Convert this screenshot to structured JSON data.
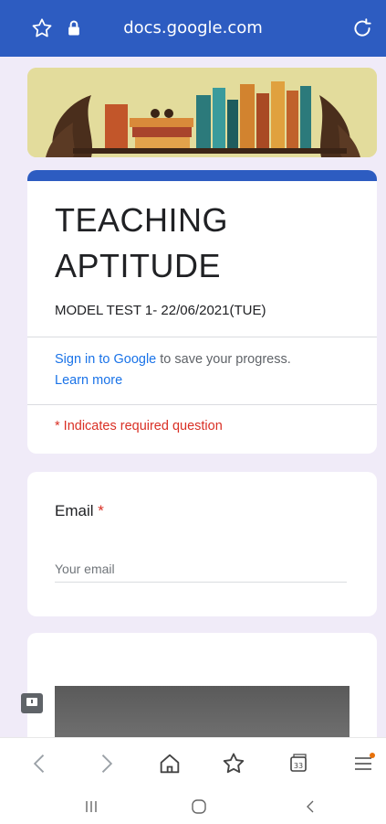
{
  "browser": {
    "url": "docs.google.com",
    "icons": [
      "star-icon",
      "lock-icon",
      "reload-icon"
    ]
  },
  "form": {
    "title": "TEACHING APTITUDE",
    "description": "MODEL TEST 1- 22/06/2021(TUE)",
    "signin_link": "Sign in to Google",
    "signin_text": " to save your progress.",
    "learn_more": "Learn more",
    "required_note": "* Indicates required question"
  },
  "email_question": {
    "label": "Email",
    "required_marker": "*",
    "placeholder": "Your email"
  },
  "bottom_nav": {
    "icons": [
      "back-icon",
      "forward-icon",
      "home-icon",
      "bookmark-icon",
      "tabs-icon",
      "menu-icon"
    ],
    "tabs_count": "33"
  },
  "system_nav": {
    "icons": [
      "recents-icon",
      "home-circle-icon",
      "back-chevron-icon"
    ]
  },
  "colors": {
    "brand": "#2d5cc1",
    "background": "#f0ebf8",
    "required": "#d93025",
    "link": "#1a73e8",
    "menu_dot": "#e8710a"
  }
}
